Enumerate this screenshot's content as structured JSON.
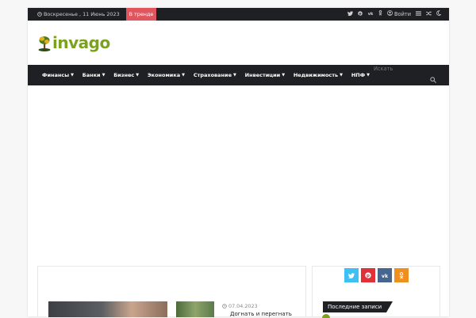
{
  "topbar": {
    "date": "Воскресенье , 11 Июнь 2023",
    "trending": "В тренде",
    "login": "Войти",
    "icons": [
      "twitter-icon",
      "pinterest-icon",
      "vk-icon",
      "odnoklassniki-icon",
      "user-icon",
      "menu-icon",
      "shuffle-icon",
      "moon-icon"
    ]
  },
  "logo": {
    "text": "invago"
  },
  "nav": {
    "items": [
      {
        "label": "Финансы"
      },
      {
        "label": "Банки"
      },
      {
        "label": "Бизнес"
      },
      {
        "label": "Экономика"
      },
      {
        "label": "Страхование"
      },
      {
        "label": "Инвестиции"
      },
      {
        "label": "Недвижимость"
      },
      {
        "label": "НПФ"
      }
    ]
  },
  "search": {
    "placeholder": "Искать"
  },
  "post": {
    "date": "07.04.2023",
    "title": "Догнать и перегнать"
  },
  "sidebar": {
    "social": [
      {
        "name": "twitter",
        "glyph": "t",
        "color": "#40bff5"
      },
      {
        "name": "pinterest",
        "glyph": "p",
        "color": "#e13138"
      },
      {
        "name": "vk",
        "glyph": "vk",
        "color": "#45668e"
      },
      {
        "name": "odnoklassniki",
        "glyph": "ok",
        "color": "#ef8f1d"
      }
    ],
    "latest_label": "Последние записи"
  },
  "colors": {
    "dark": "#1f2024",
    "accent": "#e1555f",
    "brand": "#7aa21e"
  }
}
